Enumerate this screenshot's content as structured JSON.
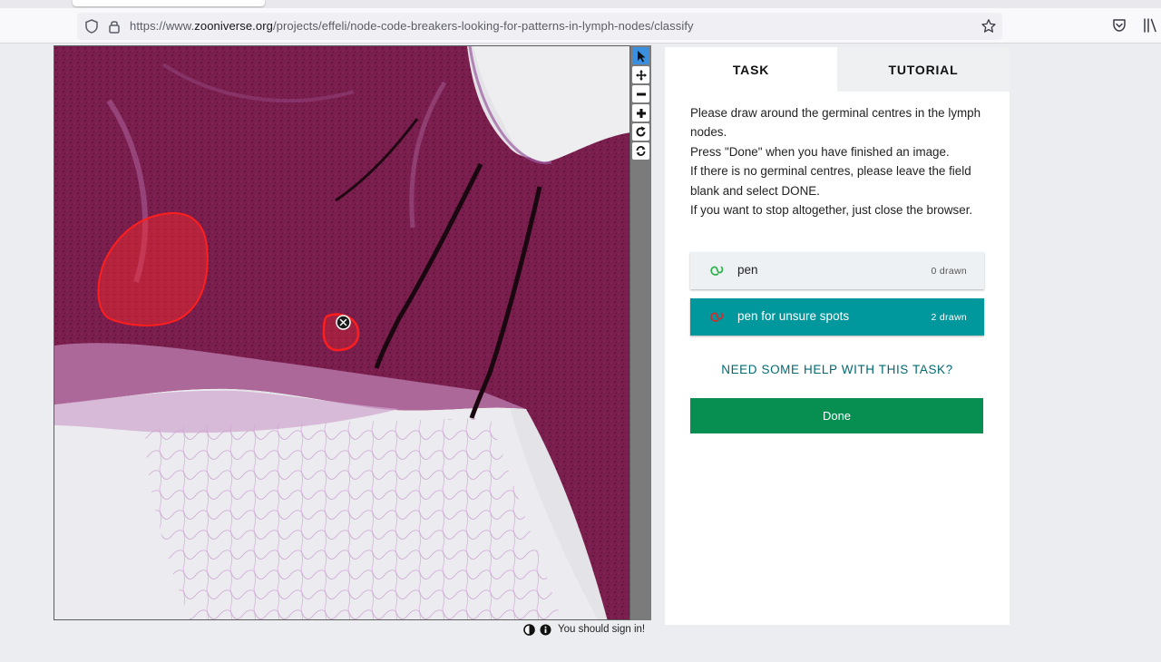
{
  "browser": {
    "url_prefix": "https://www.",
    "url_domain": "zooniverse.org",
    "url_path": "/projects/effeli/node-code-breakers-looking-for-patterns-in-lymph-nodes/classify"
  },
  "icons": {
    "shield": "shield-icon",
    "lock": "lock-icon",
    "bookmark": "star-icon",
    "pocket": "pocket-icon",
    "library": "library-icon",
    "select": "cursor-icon",
    "pan": "move-icon",
    "zoom_out": "minus-icon",
    "zoom_in": "plus-icon",
    "rotate": "rotate-icon",
    "reset": "reset-icon",
    "contrast": "contrast-icon",
    "info": "info-icon",
    "delete_mark": "close-circle-icon"
  },
  "viewer": {
    "signin_text": "You should sign in!"
  },
  "panel": {
    "tab_task": "TASK",
    "tab_tutorial": "TUTORIAL",
    "instructions": [
      "Please draw around the germinal centres in the lymph nodes.",
      "Press \"Done\" when you have finished an image.",
      "If there is no germinal centres, please leave the field blank and select DONE.",
      "If you want to stop altogether, just close the browser."
    ],
    "tools": [
      {
        "label": "pen",
        "count": "0 drawn",
        "color": "#2bb34a",
        "active": false
      },
      {
        "label": "pen for unsure spots",
        "count": "2 drawn",
        "color": "#d42a2a",
        "active": true
      }
    ],
    "help_link": "NEED SOME HELP WITH THIS TASK?",
    "done_label": "Done"
  },
  "colors": {
    "accent_teal": "#00979d",
    "done_green": "#078f52",
    "help_link": "#006a71",
    "annotation_red": "#ff1e1e"
  }
}
